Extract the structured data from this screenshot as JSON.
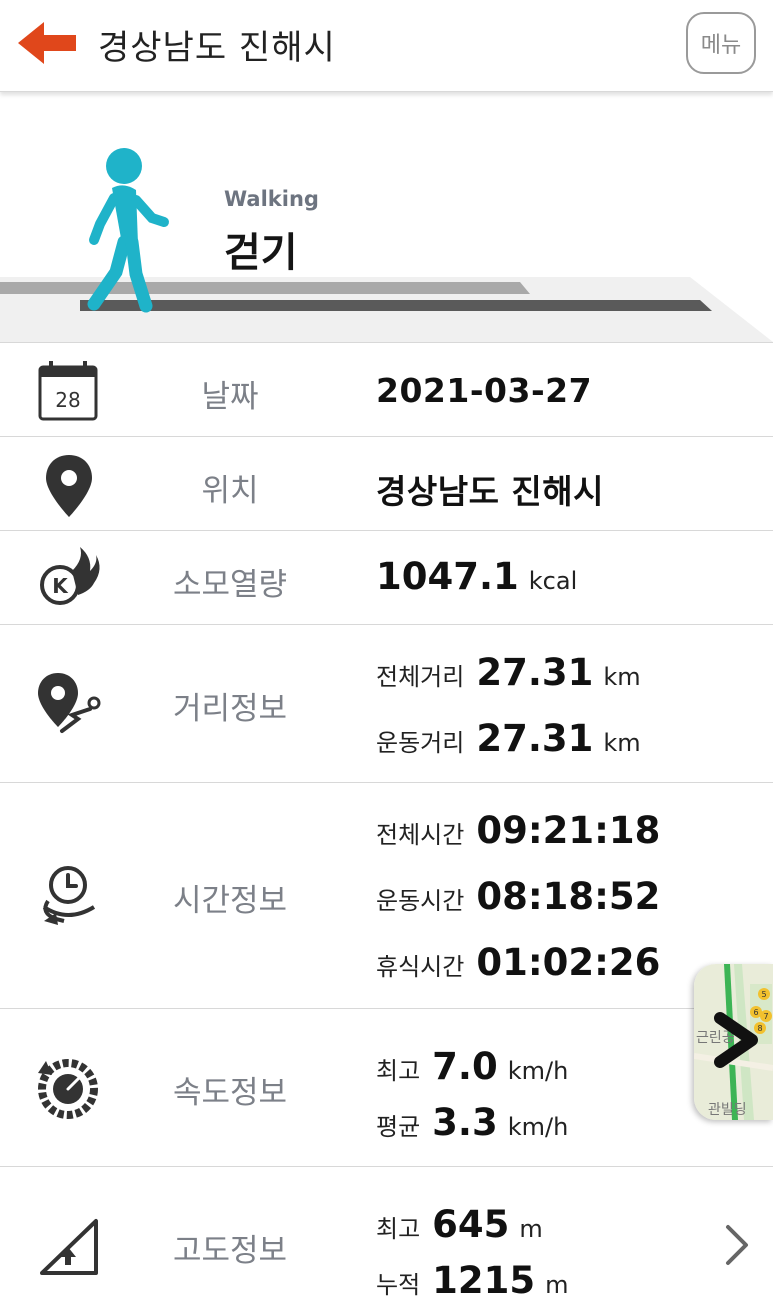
{
  "header": {
    "title": "경상남도 진해시",
    "menu_label": "메뉴",
    "accent_color": "#e0471b"
  },
  "activity": {
    "name_en": "Walking",
    "name_ko": "걷기",
    "icon": "walking-person-icon",
    "icon_color": "#1fb3c9"
  },
  "rows": {
    "date": {
      "label": "날짜",
      "value": "2021-03-27",
      "icon": "calendar-icon",
      "icon_text": "28"
    },
    "location": {
      "label": "위치",
      "value": "경상남도 진해시",
      "icon": "map-pin-icon"
    },
    "calories": {
      "label": "소모열량",
      "value": "1047.1",
      "unit": "kcal",
      "icon": "calorie-fire-icon",
      "icon_text": "K"
    },
    "distance": {
      "label": "거리정보",
      "icon": "route-pin-icon",
      "items": [
        {
          "label": "전체거리",
          "value": "27.31",
          "unit": "km"
        },
        {
          "label": "운동거리",
          "value": "27.31",
          "unit": "km"
        }
      ]
    },
    "time": {
      "label": "시간정보",
      "icon": "stopwatch-icon",
      "items": [
        {
          "label": "전체시간",
          "value": "09:21:18"
        },
        {
          "label": "운동시간",
          "value": "08:18:52"
        },
        {
          "label": "휴식시간",
          "value": "01:02:26"
        }
      ]
    },
    "speed": {
      "label": "속도정보",
      "icon": "speedometer-icon",
      "items": [
        {
          "label": "최고",
          "value": "7.0",
          "unit": "km/h"
        },
        {
          "label": "평균",
          "value": "3.3",
          "unit": "km/h"
        }
      ]
    },
    "altitude": {
      "label": "고도정보",
      "icon": "altitude-slope-icon",
      "items": [
        {
          "label": "최고",
          "value": "645",
          "unit": "m"
        },
        {
          "label": "누적",
          "value": "1215",
          "unit": "m"
        }
      ]
    }
  },
  "map_thumbnail": {
    "icon": "map-thumbnail",
    "text_top": "근린공",
    "text_bottom": "관빌딩",
    "badges": [
      "5",
      "6",
      "7",
      "8"
    ]
  }
}
